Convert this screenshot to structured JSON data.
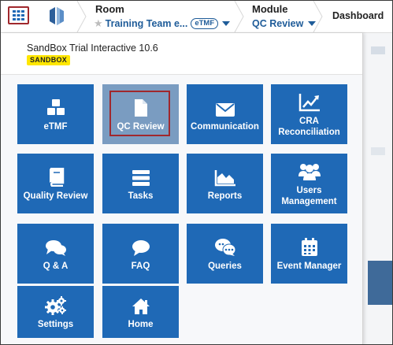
{
  "topbar": {
    "room_label": "Room",
    "room_name": "Training Team e...",
    "room_badge": "eTMF",
    "module_label": "Module",
    "module_name": "QC Review",
    "dashboard_label": "Dashboard"
  },
  "panel": {
    "app_name": "SandBox Trial Interactive 10.6",
    "env_badge": "SANDBOX"
  },
  "tiles": [
    {
      "label": "eTMF",
      "icon": "cubes-icon"
    },
    {
      "label": "QC Review",
      "icon": "document-icon",
      "active": true
    },
    {
      "label": "Communication",
      "icon": "envelope-icon"
    },
    {
      "label_line1": "CRA",
      "label_line2": "Reconciliation",
      "icon": "trend-chart-icon"
    },
    {
      "label": "Quality Review",
      "icon": "book-icon"
    },
    {
      "label": "Tasks",
      "icon": "tasks-icon"
    },
    {
      "label": "Reports",
      "icon": "area-chart-icon"
    },
    {
      "label_line1": "Users",
      "label_line2": "Management",
      "icon": "users-icon"
    },
    {
      "label": "Q & A",
      "icon": "chat-bubbles-icon"
    },
    {
      "label": "FAQ",
      "icon": "speech-bubble-icon"
    },
    {
      "label": "Queries",
      "icon": "chat-dots-icon"
    },
    {
      "label": "Event Manager",
      "icon": "calendar-icon"
    },
    {
      "label": "Settings",
      "icon": "gears-icon"
    },
    {
      "label": "Home",
      "icon": "home-icon"
    }
  ],
  "colors": {
    "tile_blue": "#1f69b6",
    "tile_active": "#7a9cc1",
    "highlight_red": "#a0282d",
    "link_blue": "#1f5c99",
    "sandbox_yellow": "#ffe600"
  }
}
